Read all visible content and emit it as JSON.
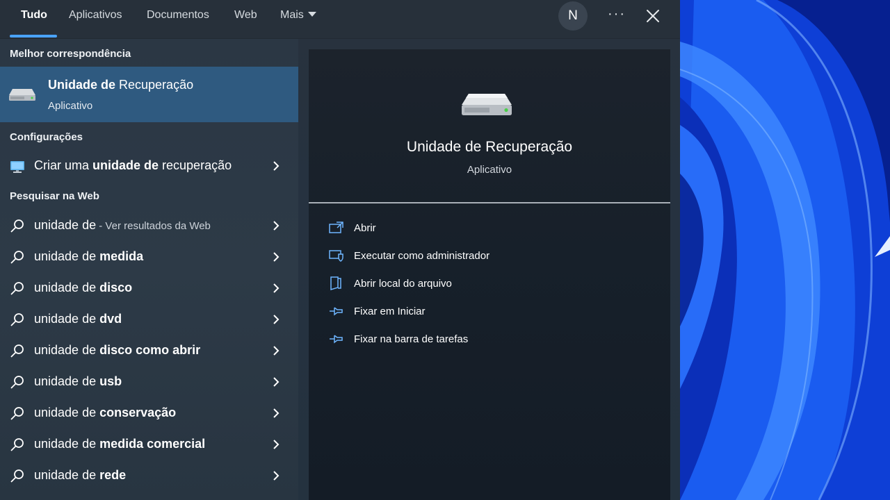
{
  "tabs": [
    {
      "label": "Tudo",
      "active": true
    },
    {
      "label": "Aplicativos"
    },
    {
      "label": "Documentos"
    },
    {
      "label": "Web"
    },
    {
      "label": "Mais"
    }
  ],
  "user_initial": "N",
  "more_options_glyph": "···",
  "sections": {
    "best_match": "Melhor correspondência",
    "settings": "Configurações",
    "web": "Pesquisar na Web"
  },
  "best_match": {
    "title_bold": "Unidade de",
    "title_rest": " Recuperação",
    "subtitle": "Aplicativo",
    "icon": "drive-icon"
  },
  "settings_items": [
    {
      "pre": "Criar uma ",
      "bold": "unidade de",
      "post": " recuperação",
      "icon": "monitor-icon"
    }
  ],
  "web_items": [
    {
      "pre": "unidade de",
      "bold": "",
      "suffix": " - Ver resultados da Web"
    },
    {
      "pre": "unidade de ",
      "bold": "medida"
    },
    {
      "pre": "unidade de ",
      "bold": "disco"
    },
    {
      "pre": "unidade de ",
      "bold": "dvd"
    },
    {
      "pre": "unidade de ",
      "bold": "disco como abrir"
    },
    {
      "pre": "unidade de ",
      "bold": "usb"
    },
    {
      "pre": "unidade de ",
      "bold": "conservação"
    },
    {
      "pre": "unidade de ",
      "bold": "medida comercial"
    },
    {
      "pre": "unidade de ",
      "bold": "rede"
    }
  ],
  "detail": {
    "title": "Unidade de Recuperação",
    "subtitle": "Aplicativo",
    "actions": [
      {
        "label": "Abrir",
        "icon": "open-icon"
      },
      {
        "label": "Executar como administrador",
        "icon": "admin-shield-icon"
      },
      {
        "label": "Abrir local do arquivo",
        "icon": "file-location-icon"
      },
      {
        "label": "Fixar em Iniciar",
        "icon": "pin-icon"
      },
      {
        "label": "Fixar na barra de tarefas",
        "icon": "pin-icon"
      }
    ]
  },
  "colors": {
    "accent": "#4aa3ff",
    "selected_row": "#2f5a80",
    "wallpaper_blue": "#0b2fc0"
  }
}
